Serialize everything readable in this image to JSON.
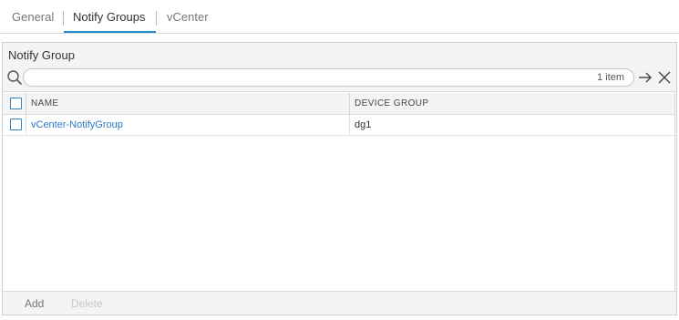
{
  "tabs": [
    {
      "label": "General",
      "active": false
    },
    {
      "label": "Notify Groups",
      "active": true
    },
    {
      "label": "vCenter",
      "active": false
    }
  ],
  "panel": {
    "title": "Notify Group",
    "search": {
      "placeholder": "",
      "value": "",
      "count_label": "1 item"
    },
    "icons": {
      "search": "search-icon",
      "apply": "arrow-right-icon",
      "clear": "close-icon"
    }
  },
  "table": {
    "columns": [
      "NAME",
      "DEVICE GROUP"
    ],
    "rows": [
      {
        "name": "vCenter-NotifyGroup",
        "device_group": "dg1",
        "checked": false
      }
    ]
  },
  "footer": {
    "add_label": "Add",
    "delete_label": "Delete",
    "delete_enabled": false
  },
  "colors": {
    "accent": "#1e88c9",
    "link": "#2a78c4",
    "checkbox": "#2f84c6"
  }
}
